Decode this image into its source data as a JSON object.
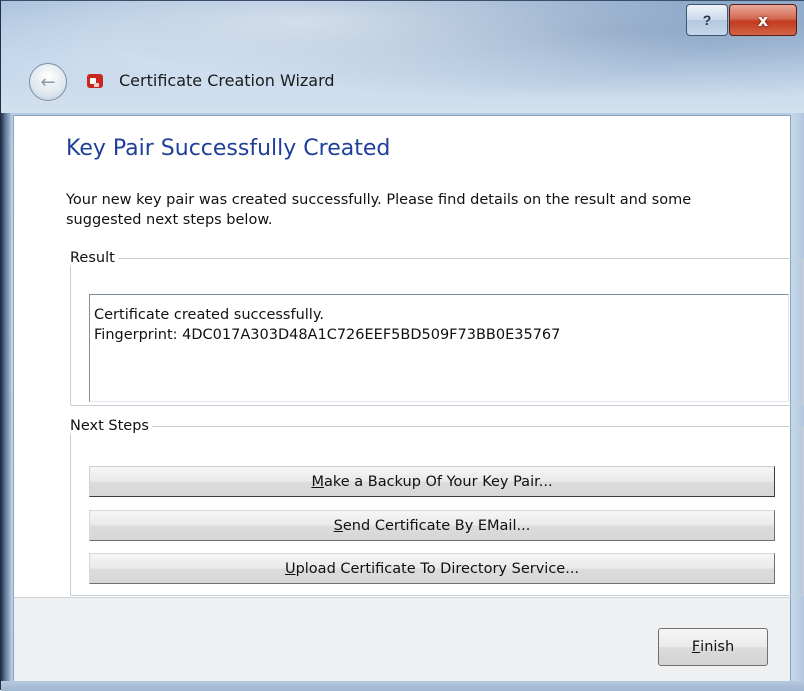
{
  "window": {
    "help_label": "?",
    "close_label": "x",
    "title": "Certificate Creation Wizard"
  },
  "page": {
    "heading": "Key Pair Successfully Created",
    "intro": "Your new key pair was created successfully. Please find details on the result and some suggested next steps below."
  },
  "result": {
    "legend": "Result",
    "line1": "Certificate created successfully.",
    "line2": "Fingerprint: 4DC017A303D48A1C726EEF5BD509F73BB0E35767"
  },
  "next_steps": {
    "legend": "Next Steps",
    "buttons": [
      {
        "mnemonic": "M",
        "rest": "ake a Backup Of Your Key Pair..."
      },
      {
        "mnemonic": "S",
        "rest": "end Certificate By EMail..."
      },
      {
        "mnemonic": "U",
        "rest": "pload Certificate To Directory Service..."
      }
    ]
  },
  "footer": {
    "finish_mnemonic": "F",
    "finish_rest": "inish"
  },
  "icons": {
    "back": "back-arrow-icon",
    "app": "certificate-app-icon",
    "accent": "#1e3f9a",
    "app_icon_color": "#c8281e"
  }
}
